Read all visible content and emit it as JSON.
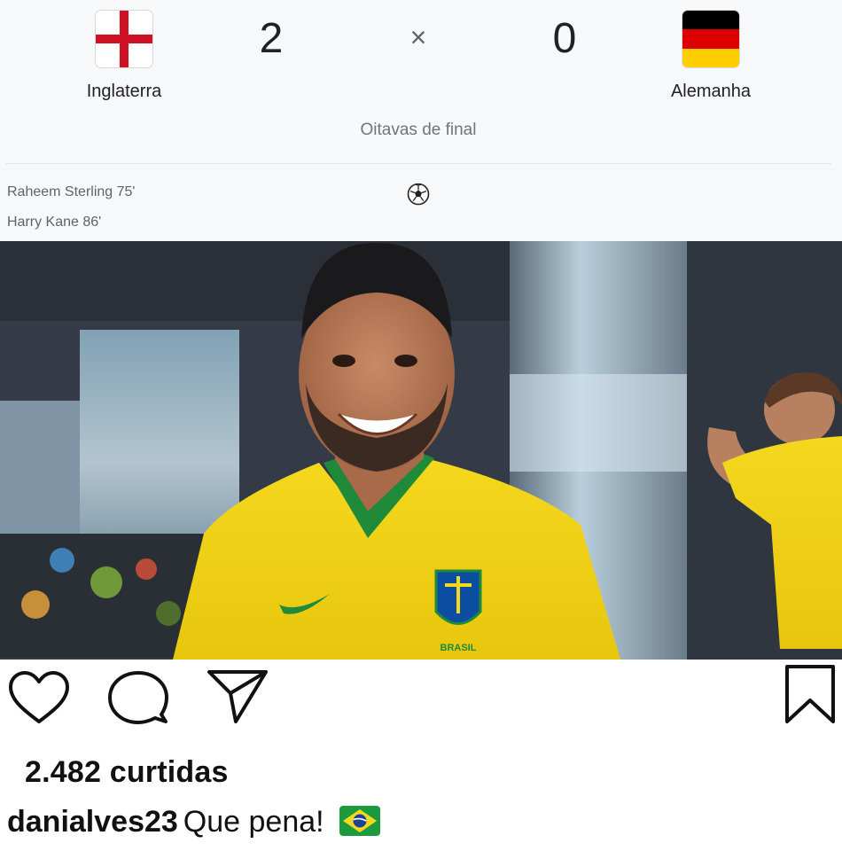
{
  "match": {
    "home": {
      "name": "Inglaterra",
      "score": "2",
      "flag": "england-flag-icon"
    },
    "away": {
      "name": "Alemanha",
      "score": "0",
      "flag": "germany-flag-icon"
    },
    "separator": "×",
    "stage": "Oitavas de final",
    "scorers": [
      {
        "text": "Raheem Sterling 75'"
      },
      {
        "text": "Harry Kane 86'"
      }
    ],
    "goal_icon": "soccer-ball-icon"
  },
  "post": {
    "likes": "2.482 curtidas",
    "username": "danialves23",
    "caption": "Que pena!",
    "caption_emoji": "brazil-flag-emoji",
    "actions": [
      "heart-icon",
      "comment-icon",
      "share-icon",
      "bookmark-icon"
    ]
  },
  "colors": {
    "jersey_yellow": "#f0d21a",
    "jersey_green": "#1e8a3a",
    "england_red": "#ce1124",
    "germany_black": "#000000",
    "germany_red": "#dd0000",
    "germany_gold": "#ffce00"
  }
}
